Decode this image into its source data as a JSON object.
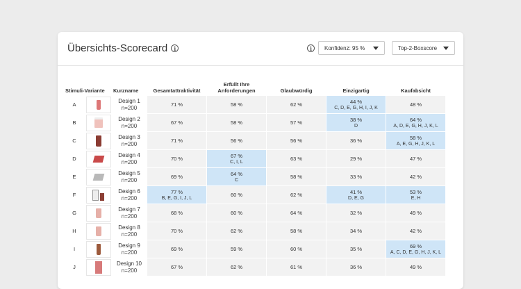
{
  "card": {
    "title": "Übersichts-Scorecard",
    "confidence_dropdown": "Konfidenz: 95 %",
    "score_dropdown": "Top-2-Boxscore"
  },
  "table": {
    "headers": [
      "Stimuli-Variante",
      "Kurzname",
      "Gesamtattraktivität",
      "Erfüllt Ihre Anforderungen",
      "Glaubwürdig",
      "Einzigartig",
      "Kaufabsicht"
    ],
    "rows": [
      {
        "letter": "A",
        "name": "Design 1",
        "n": "n=200",
        "image_icon": "pink-bottle",
        "cells": [
          {
            "v": "71 %"
          },
          {
            "v": "58 %"
          },
          {
            "v": "62 %"
          },
          {
            "v": "44 %",
            "sig": "C, D, E, G, H, I, J, K",
            "hl": true
          },
          {
            "v": "48 %"
          }
        ]
      },
      {
        "letter": "B",
        "name": "Design 2",
        "n": "n=200",
        "image_icon": "pink-jar",
        "cells": [
          {
            "v": "67 %"
          },
          {
            "v": "58 %"
          },
          {
            "v": "57 %"
          },
          {
            "v": "38 %",
            "sig": "D",
            "hl": true
          },
          {
            "v": "64 %",
            "sig": "A, D, E, G, H, J, K, L",
            "hl": true
          }
        ]
      },
      {
        "letter": "C",
        "name": "Design 3",
        "n": "n=200",
        "image_icon": "dark-bottle",
        "cells": [
          {
            "v": "71 %"
          },
          {
            "v": "56 %"
          },
          {
            "v": "56 %"
          },
          {
            "v": "36 %"
          },
          {
            "v": "58 %",
            "sig": "A, E, G, H, J, K, L",
            "hl": true
          }
        ]
      },
      {
        "letter": "D",
        "name": "Design 4",
        "n": "n=200",
        "image_icon": "red-box",
        "cells": [
          {
            "v": "70 %"
          },
          {
            "v": "67 %",
            "sig": "C, I, L",
            "hl": true
          },
          {
            "v": "63 %"
          },
          {
            "v": "29 %"
          },
          {
            "v": "47 %"
          }
        ]
      },
      {
        "letter": "E",
        "name": "Design 5",
        "n": "n=200",
        "image_icon": "gray-box",
        "cells": [
          {
            "v": "69 %"
          },
          {
            "v": "64 %",
            "sig": "C",
            "hl": true
          },
          {
            "v": "58 %"
          },
          {
            "v": "33 %"
          },
          {
            "v": "42 %"
          }
        ]
      },
      {
        "letter": "F",
        "name": "Design 6",
        "n": "n=200",
        "image_icon": "bottle-and-box",
        "cells": [
          {
            "v": "77 %",
            "sig": "B, E, G, I, J, L",
            "hl": true
          },
          {
            "v": "60 %"
          },
          {
            "v": "62 %"
          },
          {
            "v": "41 %",
            "sig": "D, E, G",
            "hl": true
          },
          {
            "v": "53 %",
            "sig": "E, H",
            "hl": true
          }
        ]
      },
      {
        "letter": "G",
        "name": "Design 7",
        "n": "n=200",
        "image_icon": "pale-jar",
        "cells": [
          {
            "v": "68 %"
          },
          {
            "v": "60 %"
          },
          {
            "v": "64 %"
          },
          {
            "v": "32 %"
          },
          {
            "v": "49 %"
          }
        ]
      },
      {
        "letter": "H",
        "name": "Design 8",
        "n": "n=200",
        "image_icon": "pale-jar",
        "cells": [
          {
            "v": "70 %"
          },
          {
            "v": "62 %"
          },
          {
            "v": "58 %"
          },
          {
            "v": "34 %"
          },
          {
            "v": "42 %"
          }
        ]
      },
      {
        "letter": "I",
        "name": "Design 9",
        "n": "n=200",
        "image_icon": "brown-bottle",
        "cells": [
          {
            "v": "69 %"
          },
          {
            "v": "59 %"
          },
          {
            "v": "60 %"
          },
          {
            "v": "35 %"
          },
          {
            "v": "69 %",
            "sig": "A, C, D, E, G, H, J, K, L",
            "hl": true
          }
        ]
      },
      {
        "letter": "J",
        "name": "Design 10",
        "n": "n=200",
        "image_icon": "pink-box",
        "cells": [
          {
            "v": "67 %"
          },
          {
            "v": "62 %"
          },
          {
            "v": "61 %"
          },
          {
            "v": "36 %"
          },
          {
            "v": "49 %"
          }
        ]
      }
    ]
  },
  "colors": {
    "highlight": "#cfe5f7",
    "cell": "#f2f2f2"
  }
}
